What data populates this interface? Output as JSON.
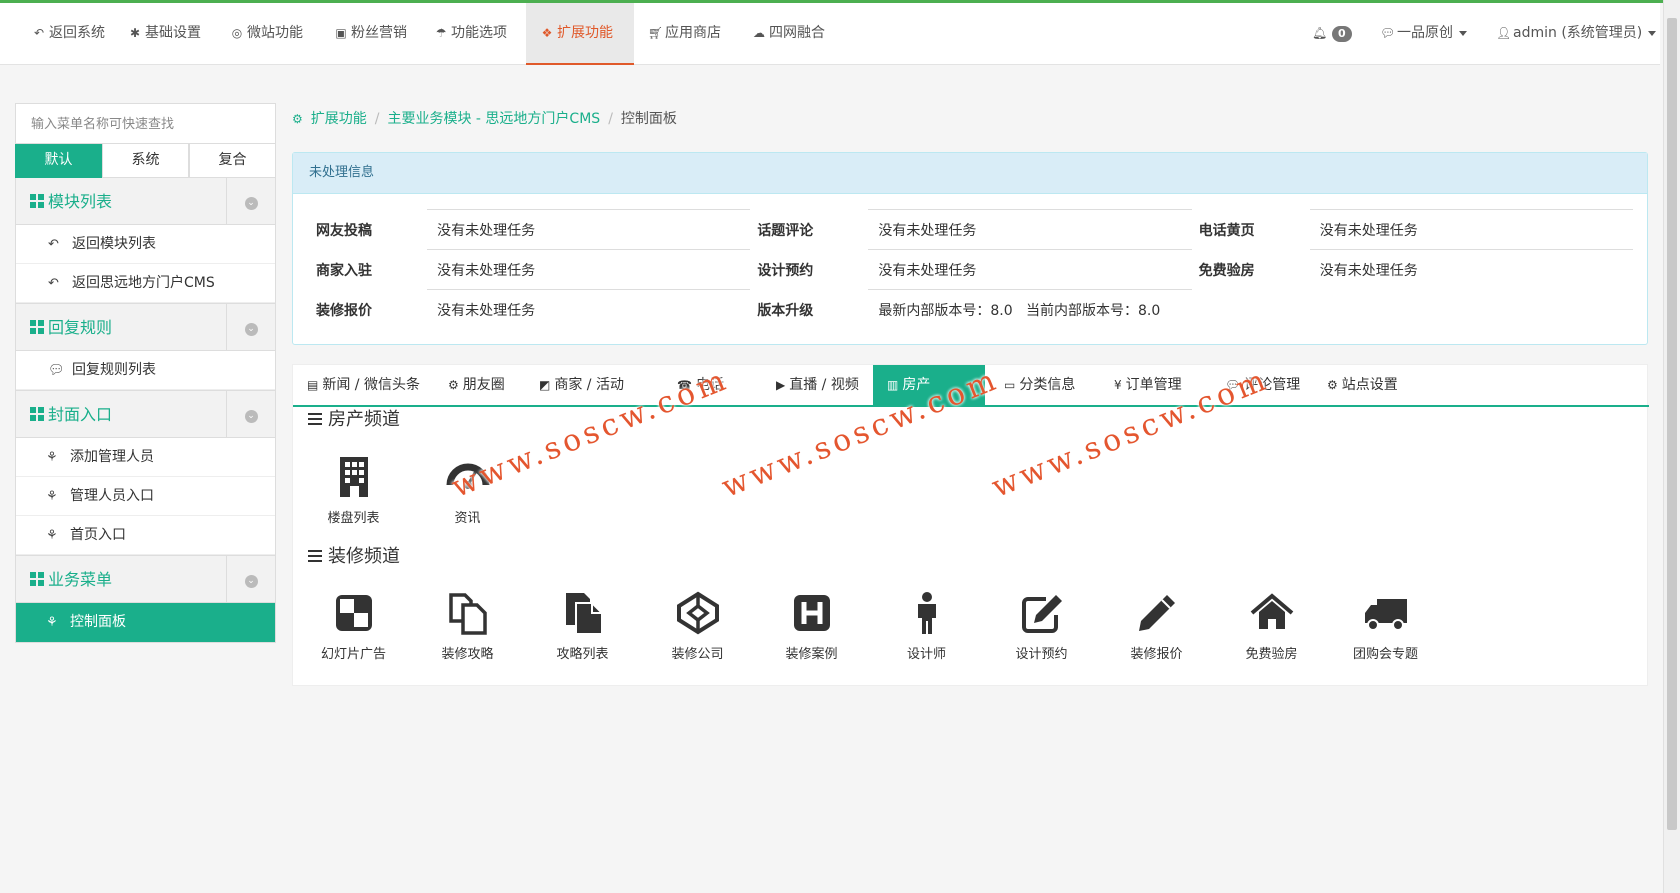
{
  "topnav": {
    "items": [
      {
        "label": "返回系统",
        "icon": "reply-icon"
      },
      {
        "label": "基础设置",
        "icon": "gear-icon"
      },
      {
        "label": "微站功能",
        "icon": "lifebuoy-icon"
      },
      {
        "label": "粉丝营销",
        "icon": "gift-icon"
      },
      {
        "label": "功能选项",
        "icon": "umbrella-icon"
      },
      {
        "label": "扩展功能",
        "icon": "cubes-icon",
        "active": true
      },
      {
        "label": "应用商店",
        "icon": "cart-icon"
      },
      {
        "label": "四网融合",
        "icon": "cloud-icon"
      }
    ],
    "notif_count": "0",
    "account_menu": "一品原创",
    "user_menu": "admin (系统管理员)",
    "accent": "#e0592a"
  },
  "sidebar": {
    "search_placeholder": "输入菜单名称可快速查找",
    "tabs": [
      "默认",
      "系统",
      "复合"
    ],
    "groups": [
      {
        "title": "模块列表",
        "items": [
          "返回模块列表",
          "返回思远地方门户CMS"
        ]
      },
      {
        "title": "回复规则",
        "items": [
          "回复规则列表"
        ]
      },
      {
        "title": "封面入口",
        "items": [
          "添加管理人员",
          "管理人员入口",
          "首页入口"
        ]
      },
      {
        "title": "业务菜单",
        "items": [
          "控制面板"
        ]
      }
    ],
    "accent": "#1aaf8b"
  },
  "breadcrumb": {
    "items": [
      "扩展功能",
      "主要业务模块 - 思远地方门户CMS",
      "控制面板"
    ]
  },
  "pending": {
    "title": "未处理信息",
    "rows": [
      [
        {
          "k": "网友投稿",
          "v": "没有未处理任务"
        },
        {
          "k": "话题评论",
          "v": "没有未处理任务"
        },
        {
          "k": "电话黄页",
          "v": "没有未处理任务"
        }
      ],
      [
        {
          "k": "商家入驻",
          "v": "没有未处理任务"
        },
        {
          "k": "设计预约",
          "v": "没有未处理任务"
        },
        {
          "k": "免费验房",
          "v": "没有未处理任务"
        }
      ],
      [
        {
          "k": "装修报价",
          "v": "没有未处理任务"
        },
        {
          "k": "版本升级",
          "v": "最新内部版本号：8.0   当前内部版本号：8.0"
        },
        {
          "k": "",
          "v": ""
        }
      ]
    ]
  },
  "content": {
    "tabs": [
      {
        "label": "新闻 / 微信头条",
        "icon": "newspaper-icon"
      },
      {
        "label": "朋友圈",
        "icon": "gears-icon"
      },
      {
        "label": "商家 / 活动",
        "icon": "checker-icon"
      },
      {
        "label": "电话",
        "icon": "phone-icon"
      },
      {
        "label": "直播 / 视频",
        "icon": "play-circle-icon"
      },
      {
        "label": "房产",
        "icon": "building-icon",
        "active": true
      },
      {
        "label": "分类信息",
        "icon": "laptop-icon"
      },
      {
        "label": "订单管理",
        "icon": "yen-icon"
      },
      {
        "label": "评论管理",
        "icon": "comments-icon"
      },
      {
        "label": "站点设置",
        "icon": "gears-icon"
      }
    ],
    "sections": [
      {
        "title": "房产频道",
        "tiles": [
          {
            "label": "楼盘列表",
            "icon": "building-icon"
          },
          {
            "label": "资讯",
            "icon": "dashboard-icon"
          }
        ]
      },
      {
        "title": "装修频道",
        "tiles": [
          {
            "label": "幻灯片广告",
            "icon": "checker-icon"
          },
          {
            "label": "装修攻略",
            "icon": "files-icon"
          },
          {
            "label": "攻略列表",
            "icon": "file-icon"
          },
          {
            "label": "装修公司",
            "icon": "codepen-icon"
          },
          {
            "label": "装修案例",
            "icon": "h-square-icon"
          },
          {
            "label": "设计师",
            "icon": "male-icon"
          },
          {
            "label": "设计预约",
            "icon": "edit-icon"
          },
          {
            "label": "装修报价",
            "icon": "pencil-icon"
          },
          {
            "label": "免费验房",
            "icon": "home-icon"
          },
          {
            "label": "团购会专题",
            "icon": "truck-icon"
          }
        ]
      }
    ]
  },
  "watermark": "www.soscw.com"
}
